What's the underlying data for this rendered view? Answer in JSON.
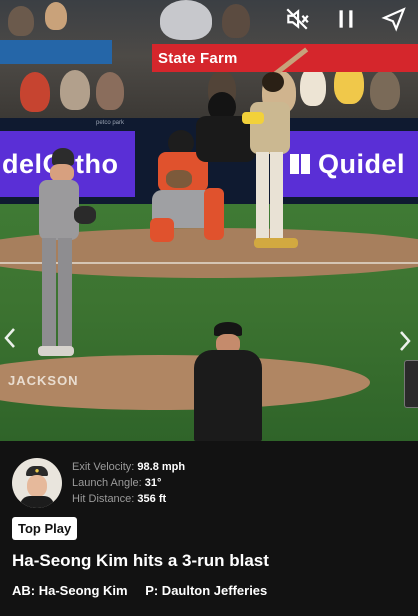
{
  "video": {
    "ads": {
      "statefarm": "State Farm",
      "left_panel": "idelOrtho",
      "right_panel": "Quidel",
      "petco": "petco park",
      "mound_logo": "JACKSON"
    },
    "controls": {
      "mute_icon": "mute-icon",
      "pause_icon": "pause-icon",
      "share_icon": "share-icon",
      "prev_icon": "chevron-left-icon",
      "next_icon": "chevron-right-icon"
    }
  },
  "player": {
    "exit_velocity_label": "Exit Velocity:",
    "exit_velocity_value": "98.8 mph",
    "launch_angle_label": "Launch Angle:",
    "launch_angle_value": "31°",
    "hit_distance_label": "Hit Distance:",
    "hit_distance_value": "356 ft"
  },
  "badge": "Top Play",
  "headline": "Ha-Seong Kim hits a 3-run blast",
  "batter": "AB: Ha-Seong Kim",
  "pitcher": "P: Daulton Jefferies",
  "colors": {
    "background": "#121212",
    "ad_red": "#d5262c",
    "panel_purple": "#5a2fd6"
  }
}
